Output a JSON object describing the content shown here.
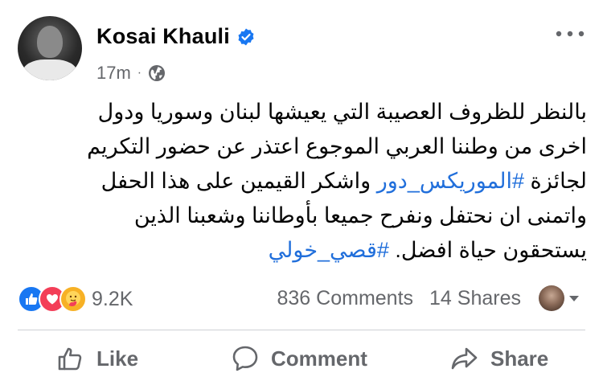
{
  "post": {
    "author": "Kosai Khauli",
    "time": "17m",
    "separator": "·",
    "text_lines": [
      "بالنظر للظروف العصيبة التي يعيشها لبنان وسوريا ودول",
      "اخرى من وطننا العربي الموجوع اعتذر عن حضور التكريم",
      "واشكر القيمين على هذا الحفل",
      "واتمنى ان نحتفل ونفرح جميعا بأوطاننا وشعبنا الذين",
      "يستحقون حياة افضل."
    ],
    "text_line3_prefix": "لجائزة",
    "hashtag_1": "#الموريكس_دور",
    "hashtag_2": "#قصي_خولي"
  },
  "stats": {
    "reactions_count": "9.2K",
    "comments": "836 Comments",
    "shares": "14 Shares"
  },
  "actions": {
    "like": "Like",
    "comment": "Comment",
    "share": "Share"
  },
  "icons": {
    "verified": "verified-badge-icon",
    "privacy": "globe-icon",
    "more": "more-options-icon",
    "reactions": [
      "like-reaction-icon",
      "love-reaction-icon",
      "care-reaction-icon"
    ]
  },
  "colors": {
    "accent": "#1877f2",
    "hashtag": "#216fdb",
    "secondary_text": "#65676b",
    "love": "#f33e58",
    "care": "#f7b125"
  }
}
